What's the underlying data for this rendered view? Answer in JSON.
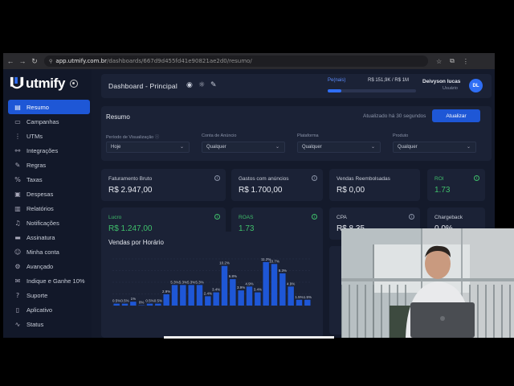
{
  "browser": {
    "url_host": "app.utmify.com.br",
    "url_path": "/dashboards/667d9d455fd41e90821ae2d0/resumo/"
  },
  "logo": {
    "text": "utmify"
  },
  "sidebar": {
    "items": [
      {
        "label": "Resumo",
        "icon": "dashboard-icon",
        "glyph": "▤",
        "active": true
      },
      {
        "label": "Campanhas",
        "icon": "megaphone-icon",
        "glyph": "▭"
      },
      {
        "label": "UTMs",
        "icon": "tag-icon",
        "glyph": "⋮"
      },
      {
        "label": "Integrações",
        "icon": "link-icon",
        "glyph": "⚯"
      },
      {
        "label": "Regras",
        "icon": "wrench-icon",
        "glyph": "✎"
      },
      {
        "label": "Taxas",
        "icon": "percent-icon",
        "glyph": "%"
      },
      {
        "label": "Despesas",
        "icon": "wallet-icon",
        "glyph": "▣"
      },
      {
        "label": "Relatórios",
        "icon": "report-icon",
        "glyph": "▥"
      },
      {
        "label": "Notificações",
        "icon": "bell-icon",
        "glyph": "♫"
      },
      {
        "label": "Assinatura",
        "icon": "card-icon",
        "glyph": "▬"
      },
      {
        "label": "Minha conta",
        "icon": "user-icon",
        "glyph": "☺"
      },
      {
        "label": "Avançado",
        "icon": "gear-icon",
        "glyph": "⚙"
      },
      {
        "label": "Indique e Ganhe 10%",
        "icon": "gift-icon",
        "glyph": "✉"
      },
      {
        "label": "Suporte",
        "icon": "help-icon",
        "glyph": "?"
      },
      {
        "label": "Aplicativo",
        "icon": "phone-icon",
        "glyph": "▯"
      },
      {
        "label": "Status",
        "icon": "pulse-icon",
        "glyph": "∿"
      }
    ]
  },
  "header": {
    "title": "Dashboard - Principal",
    "goal_label": "Pe(nais)",
    "goal_amount": "R$ 151,9K  /  R$ 1M",
    "goal_progress": 0.15,
    "user_name": "Deivyson lucas",
    "user_role": "Usuário",
    "avatar_initials": "DL"
  },
  "filters": {
    "title": "Resumo",
    "updated": "Atualizado há 30 segundos",
    "update_button": "Atualizar",
    "fields": [
      {
        "label": "Período de Visualização ⓘ",
        "value": "Hoje"
      },
      {
        "label": "Conta de Anúncio",
        "value": "Qualquer"
      },
      {
        "label": "Plataforma",
        "value": "Qualquer"
      },
      {
        "label": "Produto",
        "value": "Qualquer"
      }
    ]
  },
  "cards": {
    "faturamento": {
      "label": "Faturamento Bruto",
      "value": "R$ 2.947,00"
    },
    "gastos": {
      "label": "Gastos com anúncios",
      "value": "R$ 1.700,00"
    },
    "reembolsadas": {
      "label": "Vendas Reembolsadas",
      "value": "R$ 0,00"
    },
    "roi": {
      "label": "ROI",
      "value": "1.73"
    },
    "lucro": {
      "label": "Lucro",
      "value": "R$ 1.247,00"
    },
    "roas": {
      "label": "ROAS",
      "value": "1.73"
    },
    "cpa": {
      "label": "CPA",
      "value": "R$ 8,35"
    },
    "chargeback": {
      "label": "Chargeback",
      "value": "0,0%"
    }
  },
  "chart_data": {
    "type": "bar",
    "title": "Vendas por Horário",
    "series": [
      {
        "values": [
          0.5,
          0.5,
          1,
          0,
          0.5,
          0.5,
          2.9,
          5.3,
          5.3,
          5.3,
          5.3,
          2.4,
          3.4,
          10.2,
          6.8,
          3.9,
          4.9,
          3.4,
          11.2,
          10.7,
          8.3,
          4.9,
          1.5,
          1.5
        ],
        "labels": [
          "0.5%",
          "0.5%",
          "1%",
          "0%",
          "0.5%",
          "0.5%",
          "2.9%",
          "5.3%",
          "5.3%",
          "5.3%",
          "5.3%",
          "2.4%",
          "3.4%",
          "10.2%",
          "6.8%",
          "3.9%",
          "4.9%",
          "3.4%",
          "11.2%",
          "10.7%",
          "8.3%",
          "4.9%",
          "1.5%",
          "1.5%"
        ]
      }
    ],
    "grid": true
  }
}
